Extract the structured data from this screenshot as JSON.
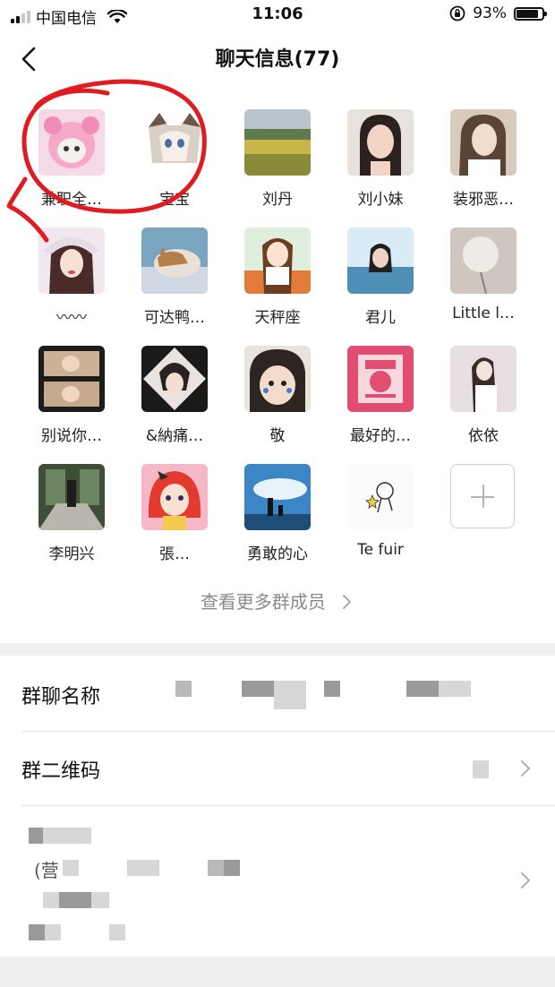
{
  "status_bar": {
    "carrier": "中国电信",
    "time": "11:06",
    "battery_pct": "93%",
    "battery_level": 0.93
  },
  "nav": {
    "title": "聊天信息(77)"
  },
  "members": [
    {
      "name": "兼职全…",
      "avatar": "pink-kitten"
    },
    {
      "name": "宝宝",
      "avatar": "ragdoll-cat"
    },
    {
      "name": "刘丹",
      "avatar": "field-landscape"
    },
    {
      "name": "刘小妹",
      "avatar": "girl-portrait"
    },
    {
      "name": "装邪恶…",
      "avatar": "girl-portrait-light"
    },
    {
      "name": "〰〰",
      "avatar": "woman-hat"
    },
    {
      "name": "可达鸭…",
      "avatar": "cat-sleeping"
    },
    {
      "name": "天秤座",
      "avatar": "anime-girl"
    },
    {
      "name": "君儿",
      "avatar": "woman-water"
    },
    {
      "name": "Little l…",
      "avatar": "dandelion"
    },
    {
      "name": "别说你…",
      "avatar": "film-strip-girls"
    },
    {
      "name": "&納痛…",
      "avatar": "diamond-girl"
    },
    {
      "name": "敬",
      "avatar": "baby-face"
    },
    {
      "name": "最好的…",
      "avatar": "pink-poster"
    },
    {
      "name": "依依",
      "avatar": "woman-bed"
    },
    {
      "name": "李明兴",
      "avatar": "garden-path"
    },
    {
      "name": "張…",
      "avatar": "anime-redhead"
    },
    {
      "name": "勇敢的心",
      "avatar": "sky-silhouette"
    },
    {
      "name": "Te   fuir",
      "avatar": "sketch-doodle"
    }
  ],
  "add_member": {
    "icon": "plus-icon"
  },
  "more_members": "查看更多群成员",
  "rows": {
    "group_name_label": "群聊名称",
    "qr_label": "群二维码",
    "notice_fragment": "(营"
  },
  "colors": {
    "scribble": "#e11b22",
    "divider": "#efefef",
    "muted_text": "#8a8a8a"
  }
}
